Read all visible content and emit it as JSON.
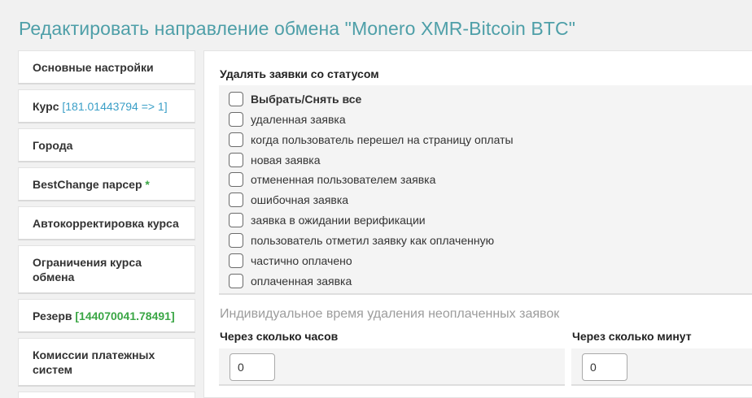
{
  "page": {
    "title": "Редактировать направление обмена \"Monero XMR-Bitcoin BTC\""
  },
  "sidebar": {
    "items": [
      {
        "label": "Основные настройки",
        "extra": ""
      },
      {
        "label": "Курс ",
        "extra": "[181.01443794 => 1]"
      },
      {
        "label": "Города",
        "extra": ""
      },
      {
        "label": "BestChange парсер ",
        "extra": "*"
      },
      {
        "label": "Автокорректировка курса",
        "extra": ""
      },
      {
        "label": "Ограничения курса обмена",
        "extra": ""
      },
      {
        "label": "Резерв ",
        "extra": "[144070041.78491]"
      },
      {
        "label": "Комиссии платежных систем",
        "extra": ""
      }
    ]
  },
  "statuses": {
    "heading": "Удалять заявки со статусом",
    "select_all": "Выбрать/Снять все",
    "items": [
      "удаленная заявка",
      "когда пользователь перешел на страницу оплаты",
      "новая заявка",
      "отмененная пользователем заявка",
      "ошибочная заявка",
      "заявка в ожидании верификации",
      "пользователь отметил заявку как оплаченную",
      "частично оплачено",
      "оплаченная заявка"
    ]
  },
  "timeout": {
    "heading": "Индивидуальное время удаления неоплаченных заявок",
    "hours_label": "Через сколько часов",
    "hours_value": "0",
    "minutes_label": "Через сколько минут",
    "minutes_value": "0"
  },
  "colors": {
    "title": "#4e9fa8",
    "accent_blue": "#3a9fc7",
    "accent_green": "#3aa645"
  }
}
